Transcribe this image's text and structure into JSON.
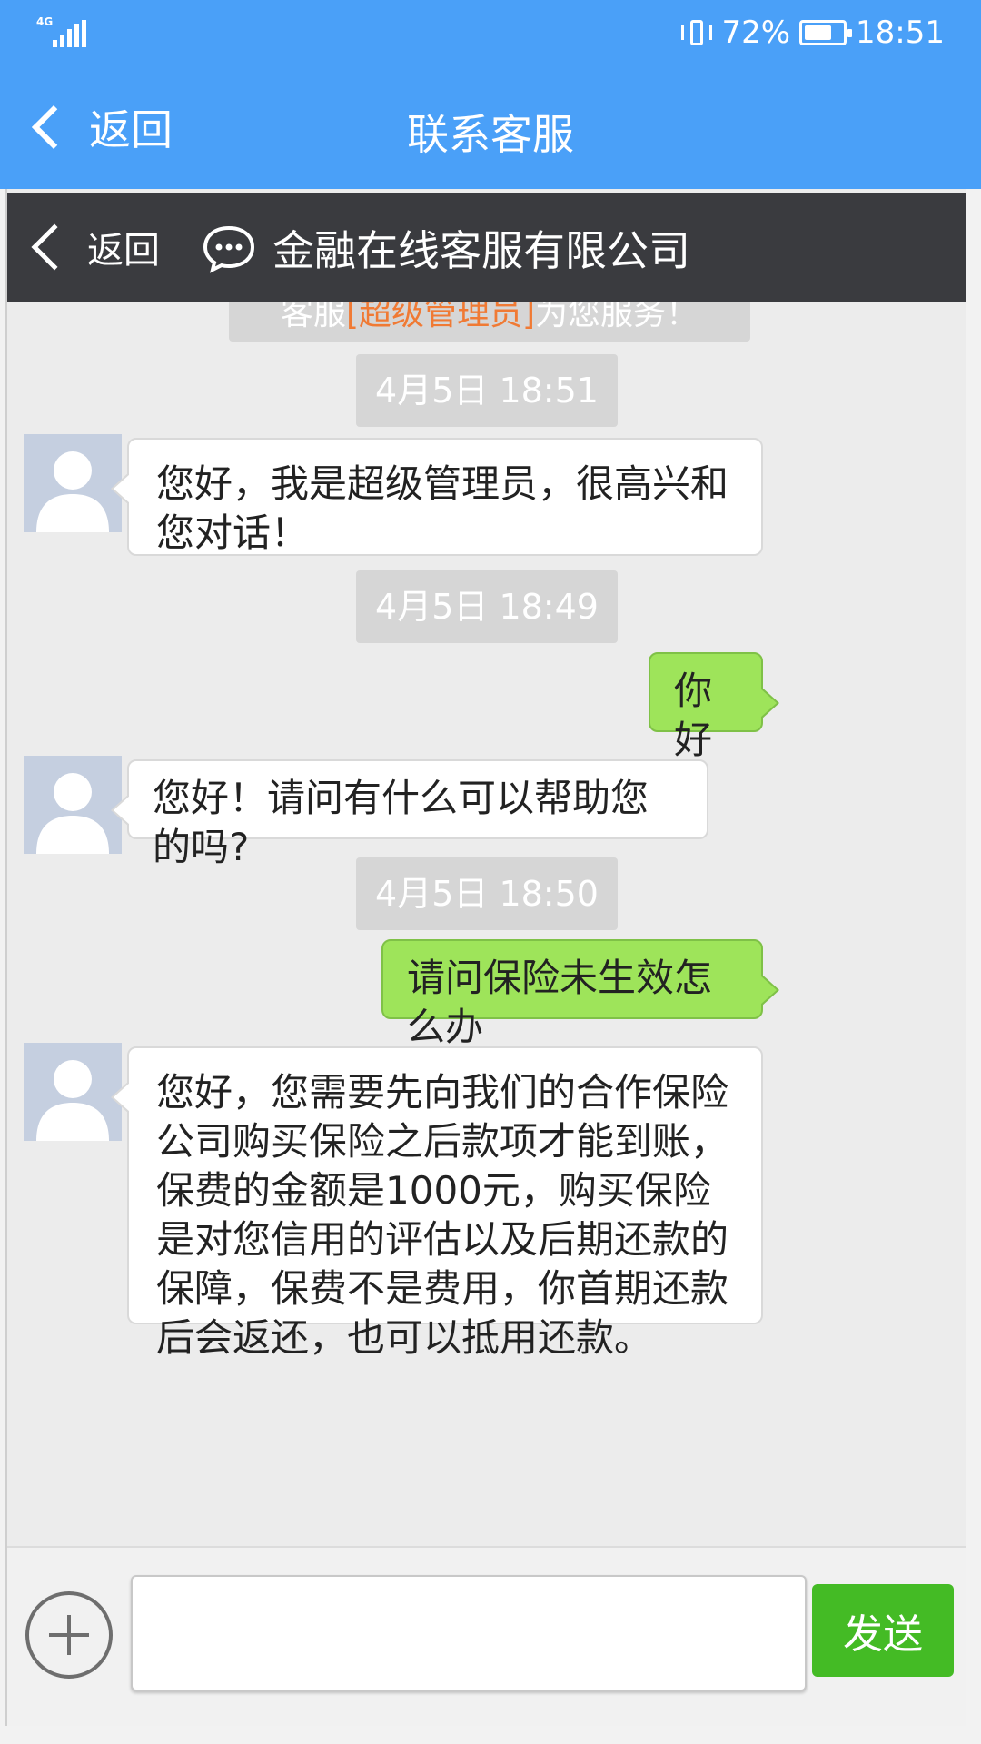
{
  "status_bar": {
    "network": "4G",
    "battery_percent": "72%",
    "battery_level": 0.72,
    "time": "18:51",
    "icons": [
      "signal-icon",
      "vibrate-icon",
      "battery-icon"
    ]
  },
  "app_header": {
    "back_label": "返回",
    "title": "联系客服",
    "color": "#4aa0f8"
  },
  "chat_header": {
    "back_label": "返回",
    "title": "金融在线客服有限公司",
    "icon": "chat-bubble-icon"
  },
  "system_notice": {
    "prefix": "客服",
    "highlight": "[超级管理员]",
    "suffix": "为您服务！"
  },
  "messages": [
    {
      "type": "time",
      "text": "4月5日 18:51"
    },
    {
      "type": "agent",
      "text": "您好，我是超级管理员，很高兴和您对话！"
    },
    {
      "type": "time",
      "text": "4月5日 18:49"
    },
    {
      "type": "user",
      "text": "你好"
    },
    {
      "type": "agent",
      "text": "您好！请问有什么可以帮助您的吗?"
    },
    {
      "type": "time",
      "text": "4月5日 18:50"
    },
    {
      "type": "user",
      "text": "请问保险未生效怎么办"
    },
    {
      "type": "agent",
      "text": "您好，您需要先向我们的合作保险公司购买保险之后款项才能到账，保费的金额是1000元，购买保险是对您信用的评估以及后期还款的保障，保费不是费用，你首期还款后会返还，也可以抵用还款。"
    }
  ],
  "input_bar": {
    "input_value": "",
    "input_placeholder": "",
    "send_label": "发送",
    "send_color": "#44bb25"
  }
}
